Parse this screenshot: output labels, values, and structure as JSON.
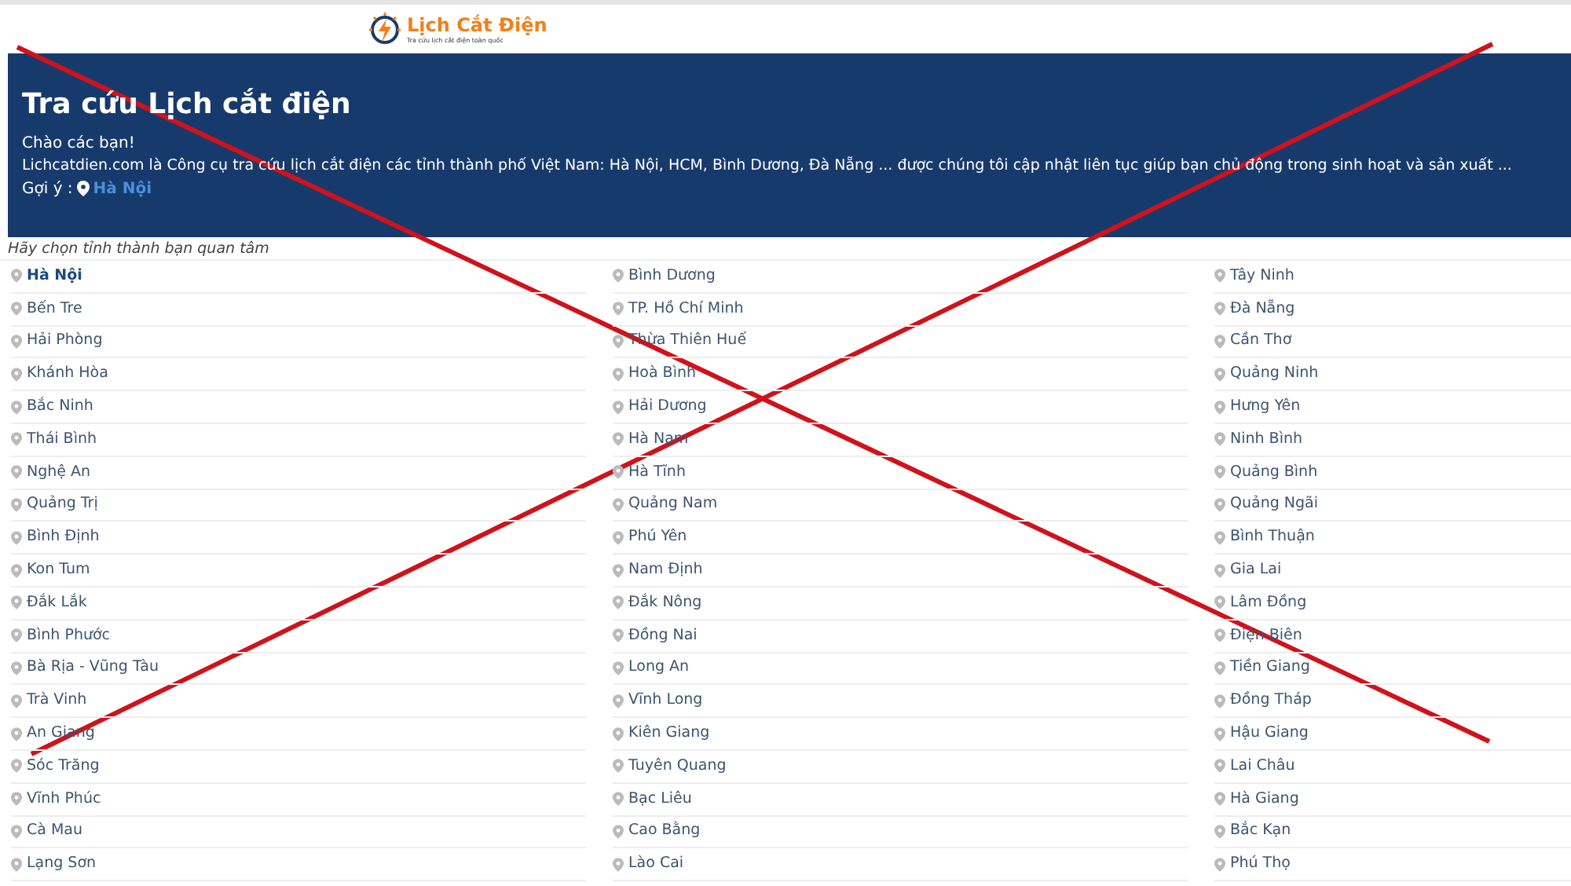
{
  "logo": {
    "name": "Lịch Cắt Điện",
    "tagline": "Tra cứu lịch cắt điện toàn quốc"
  },
  "banner": {
    "title": "Tra cứu Lịch cắt điện",
    "greeting": "Chào các bạn!",
    "description": "Lichcatdien.com là Công cụ tra cứu lịch cắt điện các tỉnh thành phố Việt Nam: Hà Nội, HCM, Bình Dương, Đà Nẵng ... được chúng tôi cập nhật liên tục giúp bạn chủ động trong sinh hoạt và sản xuất ...",
    "suggestion_label": "Gợi ý :",
    "suggestion_link": "Hà Nội"
  },
  "province_prompt": "Hãy chọn tỉnh thành bạn quan tâm",
  "columns": [
    [
      {
        "name": "Hà Nội",
        "selected": true
      },
      {
        "name": "Bến Tre",
        "selected": false
      },
      {
        "name": "Hải Phòng",
        "selected": false
      },
      {
        "name": "Khánh Hòa",
        "selected": false
      },
      {
        "name": "Bắc Ninh",
        "selected": false
      },
      {
        "name": "Thái Bình",
        "selected": false
      },
      {
        "name": "Nghệ An",
        "selected": false
      },
      {
        "name": "Quảng Trị",
        "selected": false
      },
      {
        "name": "Bình Định",
        "selected": false
      },
      {
        "name": "Kon Tum",
        "selected": false
      },
      {
        "name": "Đắk Lắk",
        "selected": false
      },
      {
        "name": "Bình Phước",
        "selected": false
      },
      {
        "name": "Bà Rịa - Vũng Tàu",
        "selected": false
      },
      {
        "name": "Trà Vinh",
        "selected": false
      },
      {
        "name": "An Giang",
        "selected": false
      },
      {
        "name": "Sóc Trăng",
        "selected": false
      },
      {
        "name": "Vĩnh Phúc",
        "selected": false
      },
      {
        "name": "Cà Mau",
        "selected": false
      },
      {
        "name": "Lạng Sơn",
        "selected": false
      }
    ],
    [
      {
        "name": "Bình Dương",
        "selected": false
      },
      {
        "name": "TP. Hồ Chí Minh",
        "selected": false
      },
      {
        "name": "Thừa Thiên Huế",
        "selected": false
      },
      {
        "name": "Hoà Bình",
        "selected": false
      },
      {
        "name": "Hải Dương",
        "selected": false
      },
      {
        "name": "Hà Nam",
        "selected": false
      },
      {
        "name": "Hà Tĩnh",
        "selected": false
      },
      {
        "name": "Quảng Nam",
        "selected": false
      },
      {
        "name": "Phú Yên",
        "selected": false
      },
      {
        "name": "Nam Định",
        "selected": false
      },
      {
        "name": "Đắk Nông",
        "selected": false
      },
      {
        "name": "Đồng Nai",
        "selected": false
      },
      {
        "name": "Long An",
        "selected": false
      },
      {
        "name": "Vĩnh Long",
        "selected": false
      },
      {
        "name": "Kiên Giang",
        "selected": false
      },
      {
        "name": "Tuyên Quang",
        "selected": false
      },
      {
        "name": "Bạc Liêu",
        "selected": false
      },
      {
        "name": "Cao Bằng",
        "selected": false
      },
      {
        "name": "Lào Cai",
        "selected": false
      }
    ],
    [
      {
        "name": "Tây Ninh",
        "selected": false
      },
      {
        "name": "Đà Nẵng",
        "selected": false
      },
      {
        "name": "Cần Thơ",
        "selected": false
      },
      {
        "name": "Quảng Ninh",
        "selected": false
      },
      {
        "name": "Hưng Yên",
        "selected": false
      },
      {
        "name": "Ninh Bình",
        "selected": false
      },
      {
        "name": "Quảng Bình",
        "selected": false
      },
      {
        "name": "Quảng Ngãi",
        "selected": false
      },
      {
        "name": "Bình Thuận",
        "selected": false
      },
      {
        "name": "Gia Lai",
        "selected": false
      },
      {
        "name": "Lâm Đồng",
        "selected": false
      },
      {
        "name": "Điện Biên",
        "selected": false
      },
      {
        "name": "Tiền Giang",
        "selected": false
      },
      {
        "name": "Đồng Tháp",
        "selected": false
      },
      {
        "name": "Hậu Giang",
        "selected": false
      },
      {
        "name": "Lai Châu",
        "selected": false
      },
      {
        "name": "Hà Giang",
        "selected": false
      },
      {
        "name": "Bắc Kạn",
        "selected": false
      },
      {
        "name": "Phú Thọ",
        "selected": false
      }
    ]
  ]
}
